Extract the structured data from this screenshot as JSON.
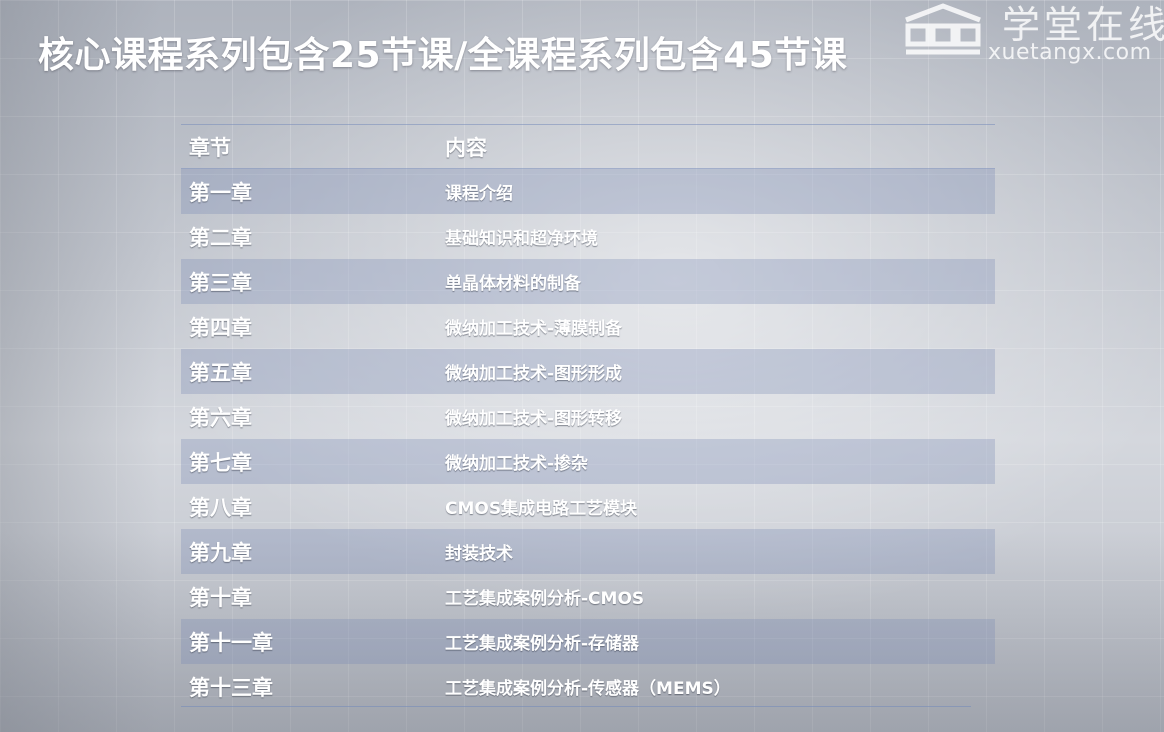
{
  "title": "核心课程系列包含25节课/全课程系列包含45节课",
  "watermark": {
    "name": "学堂在线",
    "url": "xuetangx.com",
    "icon": "xuetangx-logo-icon"
  },
  "table": {
    "headers": {
      "chapter": "章节",
      "content": "内容"
    },
    "rows": [
      {
        "chapter": "第一章",
        "content": "课程介绍"
      },
      {
        "chapter": "第二章",
        "content": "基础知识和超净环境"
      },
      {
        "chapter": "第三章",
        "content": "单晶体材料的制备"
      },
      {
        "chapter": "第四章",
        "content": "微纳加工技术-薄膜制备"
      },
      {
        "chapter": "第五章",
        "content": "微纳加工技术-图形形成"
      },
      {
        "chapter": "第六章",
        "content": "微纳加工技术-图形转移"
      },
      {
        "chapter": "第七章",
        "content": "微纳加工技术-掺杂"
      },
      {
        "chapter": "第八章",
        "content": "CMOS集成电路工艺模块"
      },
      {
        "chapter": "第九章",
        "content": "封装技术"
      },
      {
        "chapter": "第十章",
        "content": "工艺集成案例分析-CMOS"
      },
      {
        "chapter": "第十一章",
        "content": "工艺集成案例分析-存储器"
      },
      {
        "chapter": "第十三章",
        "content": "工艺集成案例分析-传感器（MEMS）"
      }
    ]
  },
  "colors": {
    "text": "#ffffff",
    "band": "#7687b2",
    "background": "#c3c7cf"
  }
}
